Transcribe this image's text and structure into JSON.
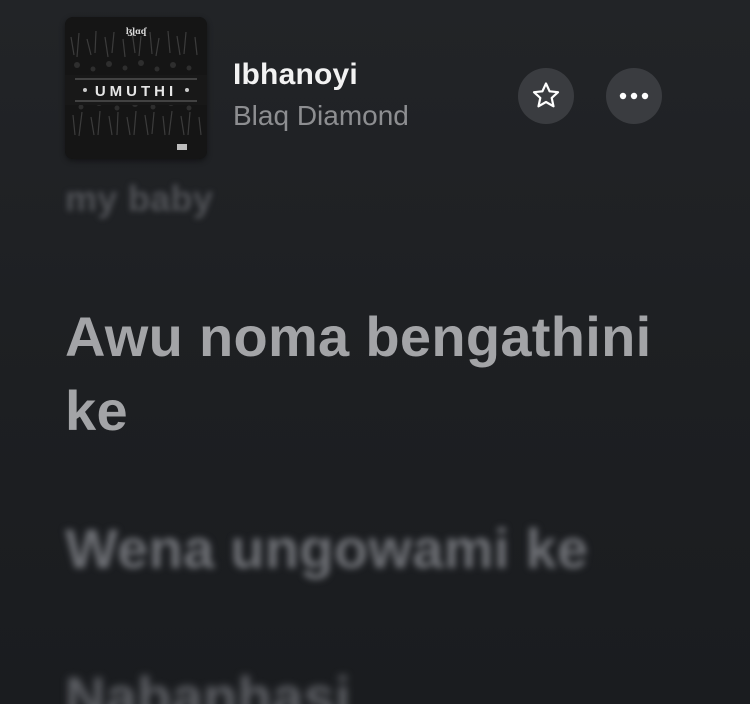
{
  "now_playing": {
    "title": "Ibhanoyi",
    "artist": "Blaq Diamond",
    "artwork": {
      "album_text": "UMUTHI",
      "top_logo_text": "ɮɭɑʠ"
    }
  },
  "actions": {
    "favorite_icon": "star-outline-icon",
    "more_icon": "ellipsis-icon"
  },
  "lyrics": {
    "previous_line": "my baby",
    "current_line": "Awu noma bengathini ke",
    "next_line": "Wena ungowami ke",
    "following_line": "Nabanhasi"
  },
  "colors": {
    "background": "#1f2124",
    "title": "#f2f2f2",
    "artist": "#8d8e91",
    "button_bg": "#3a3c40",
    "active_lyric": "#a3a4a7"
  }
}
